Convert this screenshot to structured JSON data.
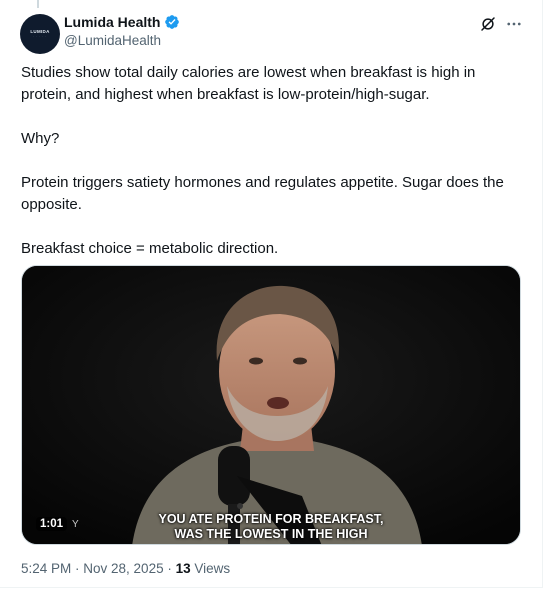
{
  "author": {
    "display_name": "Lumida Health",
    "handle": "@LumidaHealth",
    "avatar_text": "LUMIDA",
    "verified_color": "#1d9bf0"
  },
  "tweet": {
    "paragraphs": [
      "Studies show total daily calories are lowest when breakfast is high in protein, and highest when breakfast is low-protein/high-sugar.",
      "Why?",
      "Protein triggers satiety hormones and regulates appetite. Sugar does the opposite.",
      "Breakfast choice = metabolic direction."
    ]
  },
  "video": {
    "caption_line1": "YOU ATE PROTEIN FOR BREAKFAST,",
    "caption_line2": "WAS THE LOWEST IN THE HIGH",
    "duration": "1:01",
    "duration_tail": "Y"
  },
  "meta": {
    "timestamp": "5:24 PM · Nov 28, 2025",
    "separator": " · ",
    "views_count": "13",
    "views_label": " Views"
  },
  "icons": {
    "grok": "grok-icon",
    "more": "more-icon",
    "verified": "verified-badge-icon"
  },
  "colors": {
    "text": "#0f1419",
    "secondary": "#536471",
    "accent": "#1d9bf0"
  }
}
